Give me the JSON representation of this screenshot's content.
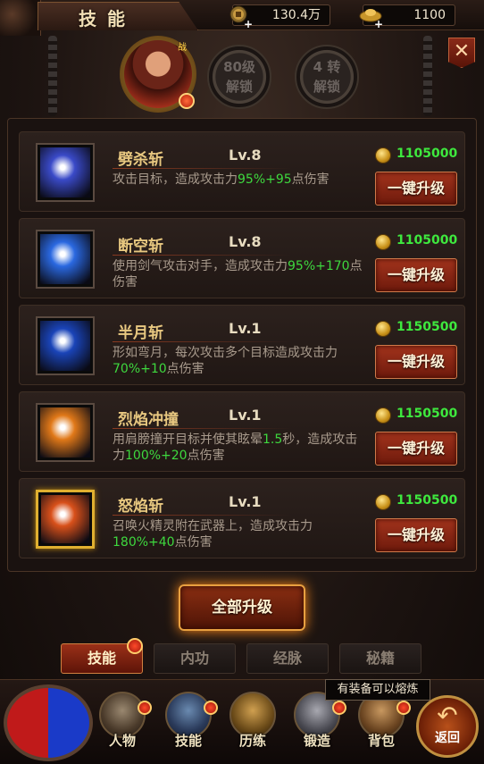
{
  "header": {
    "title": "技能",
    "resources": [
      {
        "icon": "gold-coin-icon",
        "value": "130.4万"
      },
      {
        "icon": "gold-ingot-icon",
        "value": "1100"
      }
    ]
  },
  "avatar": {
    "tag": "战"
  },
  "unlocks": [
    {
      "line1": "80级",
      "line2": "解锁"
    },
    {
      "line1": "4 转",
      "line2": "解锁"
    }
  ],
  "close_icon": "close-icon",
  "skills": [
    {
      "name": "劈杀斩",
      "level": "Lv.8",
      "cost": "1105000",
      "desc_parts": [
        "攻击目标，造成攻击力",
        "95%+95",
        "点伤害"
      ],
      "button": "一键升级",
      "color": "#3a4ac8"
    },
    {
      "name": "断空斩",
      "level": "Lv.8",
      "cost": "1105000",
      "desc_parts": [
        "使用剑气攻击对手，造成攻击力",
        "95%+170",
        "点伤害"
      ],
      "button": "一键升级",
      "color": "#2a68e0"
    },
    {
      "name": "半月斩",
      "level": "Lv.1",
      "cost": "1150500",
      "desc_parts": [
        "形如弯月，每次攻击多个目标造成攻击力",
        "70%+10",
        "点伤害"
      ],
      "button": "一键升级",
      "color": "#1a44b8"
    },
    {
      "name": "烈焰冲撞",
      "level": "Lv.1",
      "cost": "1150500",
      "desc_parts": [
        "用肩膀撞开目标并使其眩晕",
        "1.5",
        "秒，造成攻击力",
        "100%+20",
        "点伤害"
      ],
      "button": "一键升级",
      "color": "#e07818"
    },
    {
      "name": "怒焰斩",
      "level": "Lv.1",
      "cost": "1150500",
      "desc_parts": [
        "召唤火精灵附在武器上，造成攻击力",
        "180%+40",
        "点伤害"
      ],
      "button": "一键升级",
      "color": "#d8501a",
      "selected": true
    }
  ],
  "upgrade_all_label": "全部升级",
  "sub_tabs": [
    "技能",
    "内功",
    "经脉",
    "秘籍"
  ],
  "active_sub_tab": "技能",
  "bottom_nav": [
    {
      "label": "人物",
      "icon": "warrior-icon"
    },
    {
      "label": "技能",
      "icon": "skill-book-icon"
    },
    {
      "label": "历练",
      "icon": "armor-icon"
    },
    {
      "label": "锻造",
      "icon": "anvil-icon"
    },
    {
      "label": "背包",
      "icon": "bag-icon"
    }
  ],
  "tooltip": "有装备可以熔炼",
  "return_label": "返回"
}
